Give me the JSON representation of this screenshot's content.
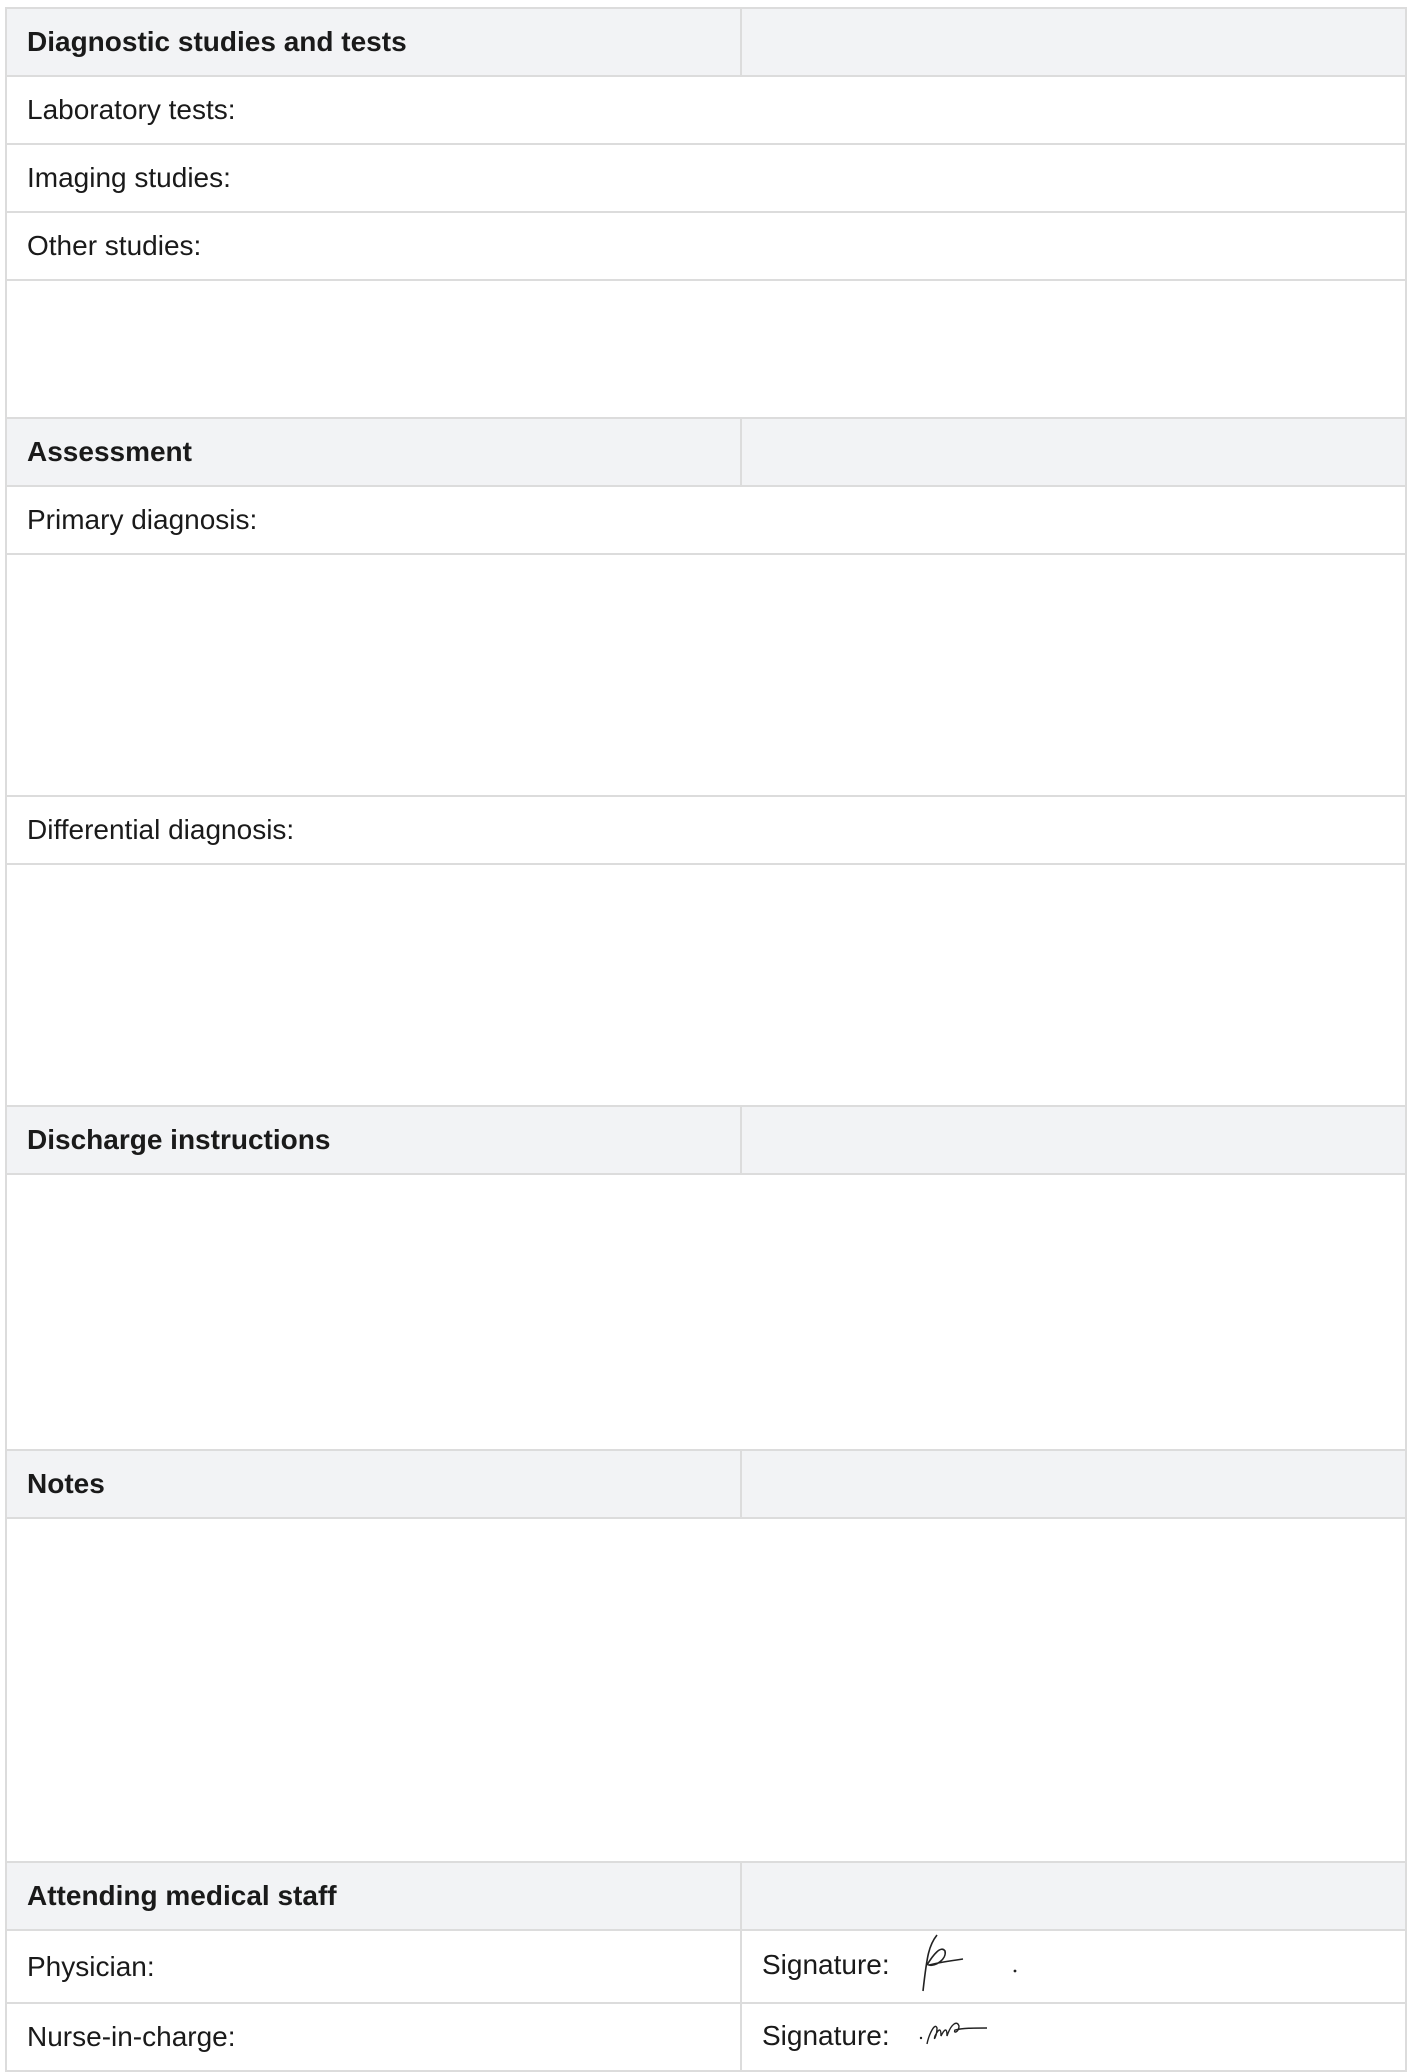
{
  "sections": {
    "diagnostics": {
      "title": "Diagnostic studies and tests",
      "laboratory_label": "Laboratory tests:",
      "imaging_label": "Imaging studies:",
      "other_label": "Other studies:"
    },
    "assessment": {
      "title": "Assessment",
      "primary_label": "Primary diagnosis:",
      "differential_label": "Differential diagnosis:"
    },
    "discharge": {
      "title": "Discharge instructions"
    },
    "notes": {
      "title": "Notes"
    },
    "staff": {
      "title": "Attending medical staff",
      "physician_label": "Physician:",
      "nurse_label": "Nurse-in-charge:",
      "signature_label": "Signature:"
    }
  },
  "colors": {
    "header_bg": "#f2f3f5",
    "border": "#dcdcdc"
  }
}
